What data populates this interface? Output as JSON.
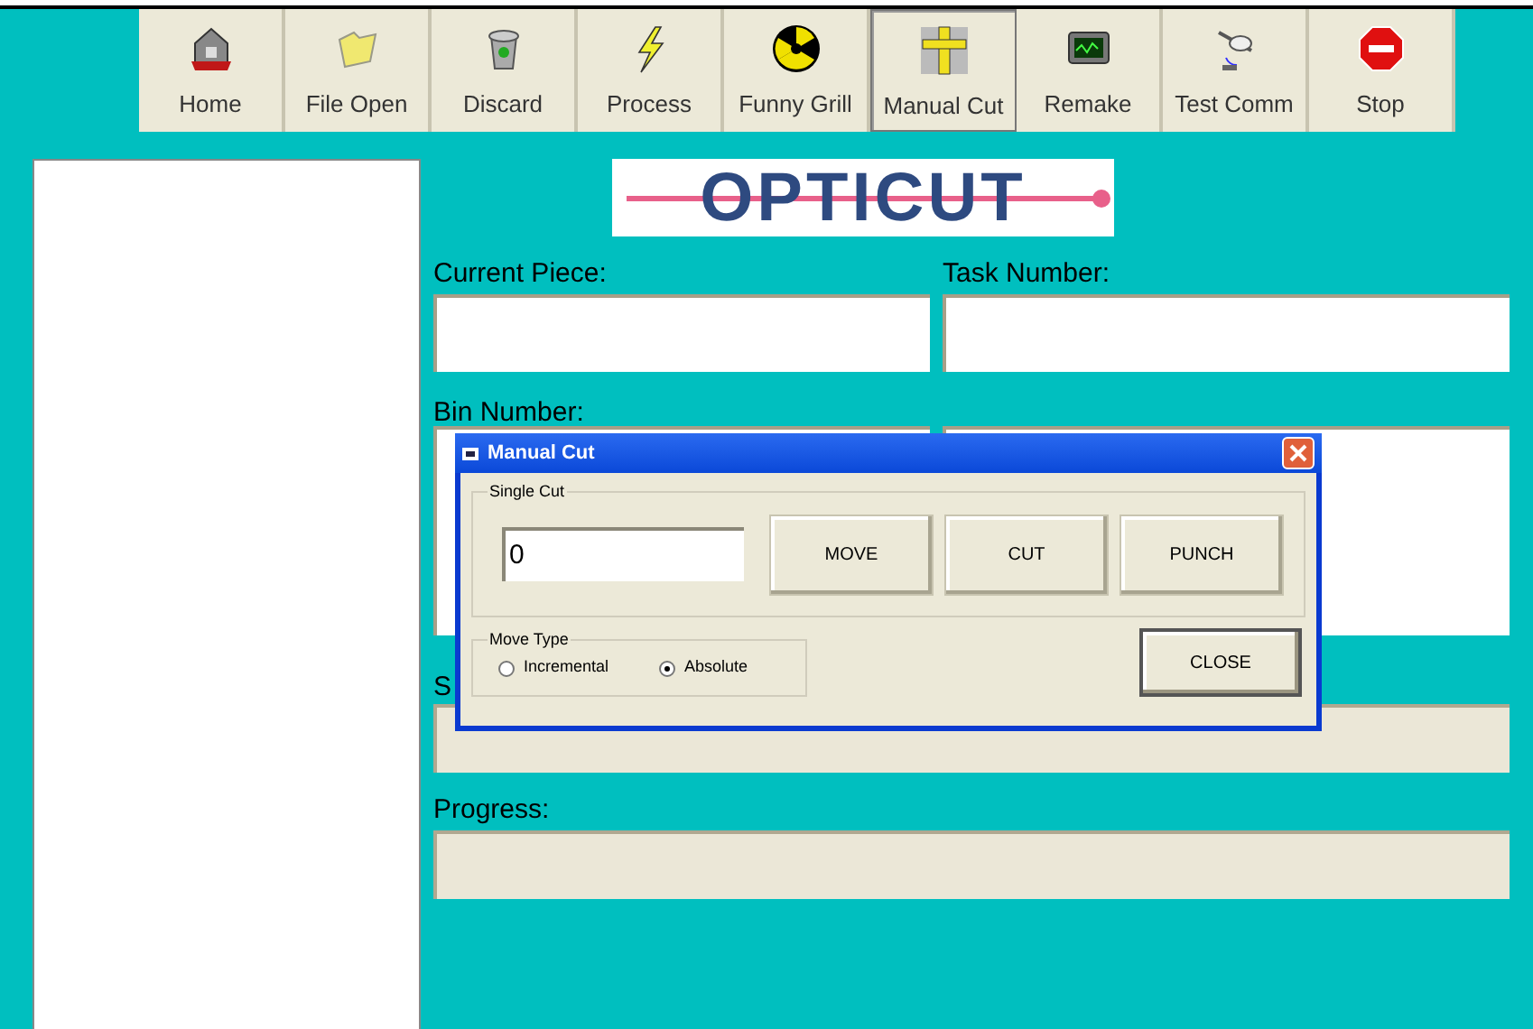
{
  "toolbar": [
    {
      "label": "Home",
      "selected": false
    },
    {
      "label": "File Open",
      "selected": false
    },
    {
      "label": "Discard",
      "selected": false
    },
    {
      "label": "Process",
      "selected": false
    },
    {
      "label": "Funny Grill",
      "selected": false
    },
    {
      "label": "Manual Cut",
      "selected": true
    },
    {
      "label": "Remake",
      "selected": false
    },
    {
      "label": "Test Comm",
      "selected": false
    },
    {
      "label": "Stop",
      "selected": false
    }
  ],
  "logo": "OPTICUT",
  "fields": {
    "current_piece": {
      "label": "Current Piece:"
    },
    "task_number": {
      "label": "Task Number:"
    },
    "bin_number": {
      "label": "Bin Number:"
    },
    "status": {
      "label": "S"
    },
    "progress": {
      "label": "Progress:"
    }
  },
  "dialog": {
    "title": "Manual Cut",
    "single_cut": {
      "legend": "Single Cut",
      "value": "0",
      "buttons": [
        "MOVE",
        "CUT",
        "PUNCH"
      ]
    },
    "move_type": {
      "legend": "Move Type",
      "options": [
        {
          "label": "Incremental",
          "selected": false
        },
        {
          "label": "Absolute",
          "selected": true
        }
      ]
    },
    "close_button": "CLOSE"
  }
}
